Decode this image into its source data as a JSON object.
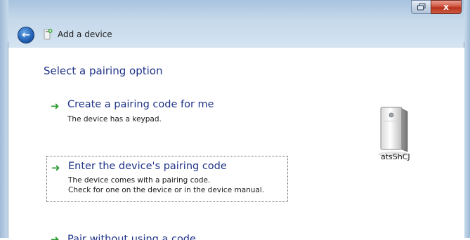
{
  "window": {
    "title": "Add a device",
    "close_glyph": "x"
  },
  "content": {
    "heading": "Select a pairing option",
    "options": [
      {
        "title": "Create a pairing code for me",
        "descriptions": [
          "The device has a keypad."
        ],
        "icon": "green-arrow-icon"
      },
      {
        "title": "Enter the device's pairing code",
        "descriptions": [
          "The device comes with a pairing code.",
          "Check for one on the device or in the device manual."
        ],
        "icon": "green-arrow-icon",
        "focused": true
      },
      {
        "title": "Pair without using a code",
        "descriptions": [],
        "icon": "green-arrow-icon",
        "partially_visible": true
      }
    ],
    "device": {
      "name": "atsShCJ",
      "icon": "device-tower-icon"
    }
  },
  "colors": {
    "heading": "#1e3287",
    "arrow": "#2d9b33",
    "close_button": "#c94a35"
  }
}
